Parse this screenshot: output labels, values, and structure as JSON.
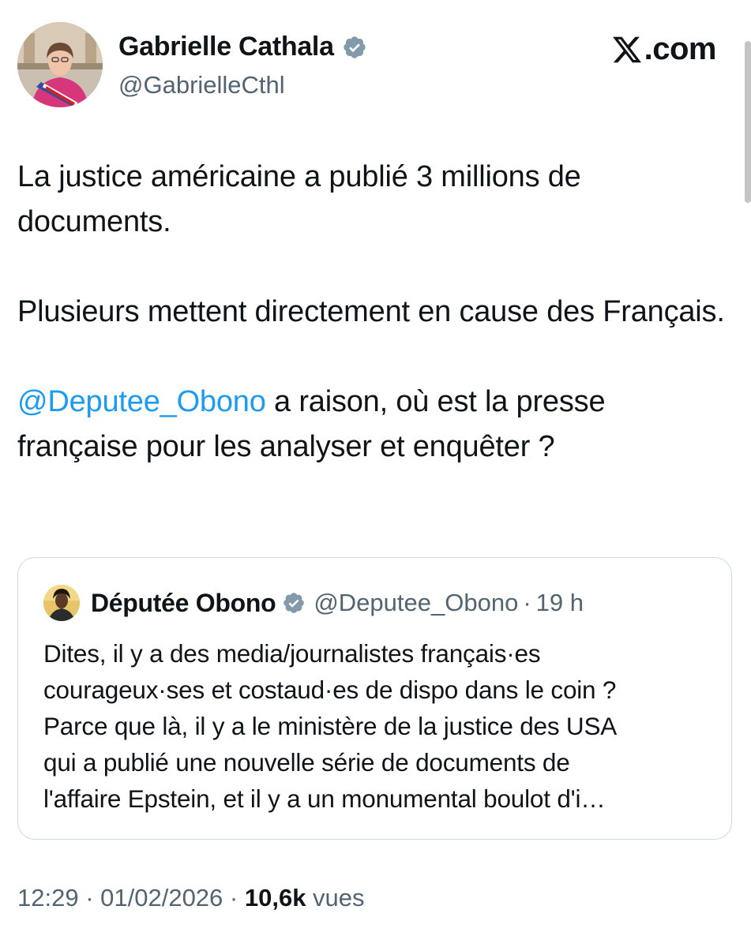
{
  "author": {
    "display_name": "Gabrielle Cathala",
    "handle": "@GabrielleCthl",
    "verified_icon": "verified-badge-icon"
  },
  "brand": {
    "label": ".com",
    "logo_icon": "x-logo-icon"
  },
  "tweet": {
    "paragraph_1": "La justice américaine a publié 3 millions de documents.",
    "paragraph_2": "Plusieurs mettent directement en cause des Français.",
    "mention": "@Deputee_Obono",
    "paragraph_3_rest": " a raison, où est la presse française pour les analyser et enquêter ?"
  },
  "quoted_tweet": {
    "display_name": "Députée Obono",
    "handle": "@Deputee_Obono",
    "separator": "·",
    "time": "19 h",
    "lines": [
      "Dites, il y a des media/journalistes français·es",
      "courageux·ses et costaud·es de dispo dans le coin ?",
      "Parce que là, il y a le ministère de la justice des USA",
      "qui a publié une nouvelle série de documents de",
      "l'affaire Epstein, et il y a un monumental boulot d'i…"
    ]
  },
  "meta": {
    "time": "12:29",
    "separator": " · ",
    "date": "01/02/2026",
    "views_count": "10,6k",
    "views_label": " vues"
  },
  "colors": {
    "accent": "#1d9bf0",
    "secondary_text": "#536471",
    "primary_text": "#0f1419",
    "border": "#cfd9de",
    "verified_badge": "#829aab"
  }
}
